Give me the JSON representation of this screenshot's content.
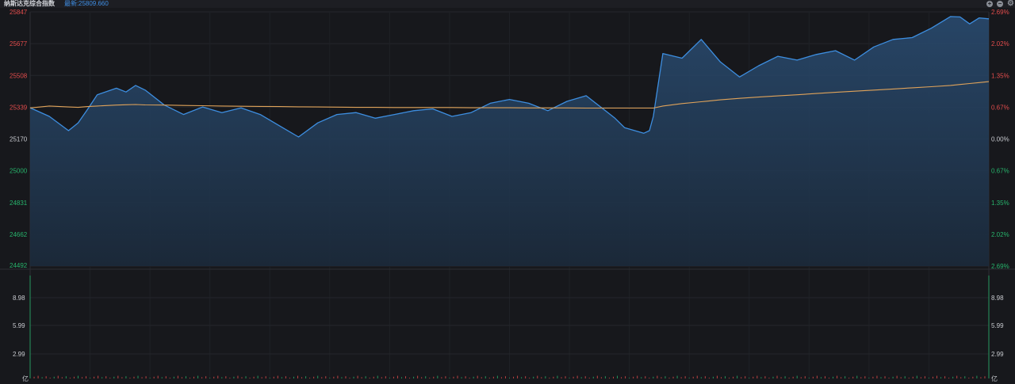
{
  "header": {
    "title": "纳斯达克综合指数",
    "latest_label": "最新:",
    "latest_value": "25809.660",
    "icons": [
      "plus-circle-icon",
      "minus-circle-icon",
      "gear-icon"
    ]
  },
  "colors": {
    "background": "#17181c",
    "price_line": "#3d8ee0",
    "average_line": "#e0a35a",
    "up": "#e24c4c",
    "down": "#27b36b",
    "neutral": "#c8cacf",
    "grid": "#24262b"
  },
  "chart_data": {
    "type": "line",
    "title": "纳斯达克综合指数",
    "prev_close": 25170,
    "ylim": [
      24492,
      25847
    ],
    "y_ticks_left": [
      "25847",
      "25677",
      "25508",
      "25339",
      "25170",
      "25000",
      "24831",
      "24662",
      "24492"
    ],
    "y_ticks_right": [
      "2.69%",
      "2.02%",
      "1.35%",
      "0.67%",
      "0.00%",
      "0.67%",
      "1.35%",
      "2.02%",
      "2.69%"
    ],
    "volume_ticks": [
      "8.98",
      "5.99",
      "2.99",
      "亿"
    ],
    "volume_unit": "亿",
    "volume_ylim": [
      0,
      11.98
    ],
    "grid": true,
    "x": [
      0,
      0.02,
      0.04,
      0.05,
      0.06,
      0.07,
      0.09,
      0.1,
      0.11,
      0.12,
      0.14,
      0.16,
      0.18,
      0.2,
      0.22,
      0.24,
      0.26,
      0.28,
      0.3,
      0.32,
      0.34,
      0.36,
      0.38,
      0.4,
      0.42,
      0.44,
      0.46,
      0.48,
      0.5,
      0.52,
      0.54,
      0.56,
      0.58,
      0.6,
      0.61,
      0.62,
      0.64,
      0.646,
      0.65,
      0.66,
      0.68,
      0.7,
      0.72,
      0.74,
      0.76,
      0.78,
      0.8,
      0.82,
      0.84,
      0.86,
      0.88,
      0.9,
      0.92,
      0.94,
      0.96,
      0.97,
      0.98,
      0.99,
      1.0
    ],
    "series": [
      {
        "values": [
          25336,
          25290,
          25214,
          25255,
          25328,
          25405,
          25440,
          25420,
          25455,
          25430,
          25350,
          25300,
          25340,
          25310,
          25335,
          25300,
          25240,
          25180,
          25255,
          25300,
          25310,
          25280,
          25300,
          25320,
          25330,
          25290,
          25310,
          25360,
          25380,
          25360,
          25320,
          25370,
          25400,
          25320,
          25280,
          25230,
          25200,
          25214,
          25290,
          25625,
          25600,
          25700,
          25580,
          25500,
          25560,
          25610,
          25590,
          25620,
          25640,
          25590,
          25660,
          25700,
          25710,
          25760,
          25822,
          25820,
          25783,
          25815,
          25810
        ]
      },
      {
        "values": [
          25335,
          25345,
          25340,
          25338,
          25342,
          25345,
          25350,
          25352,
          25353,
          25351,
          25350,
          25348,
          25347,
          25345,
          25344,
          25343,
          25342,
          25341,
          25340,
          25339,
          25338,
          25338,
          25337,
          25337,
          25337,
          25337,
          25336,
          25336,
          25336,
          25335,
          25335,
          25335,
          25334,
          25334,
          25334,
          25334,
          25334,
          25334,
          25334,
          25345,
          25358,
          25368,
          25378,
          25386,
          25393,
          25399,
          25405,
          25412,
          25418,
          25424,
          25430,
          25436,
          25442,
          25448,
          25455,
          25460,
          25465,
          25470,
          25475
        ]
      }
    ]
  }
}
